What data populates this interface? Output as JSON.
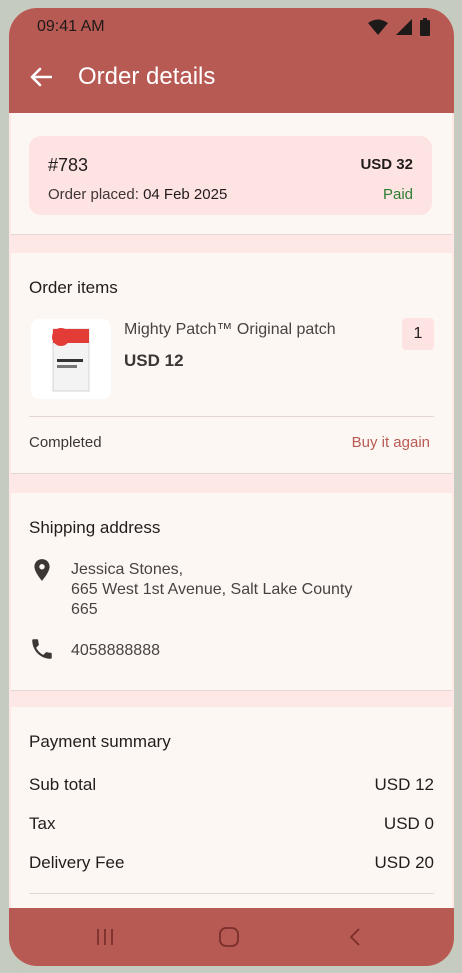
{
  "status_bar": {
    "time": "09:41 AM"
  },
  "app_bar": {
    "title": "Order details"
  },
  "order": {
    "id": "#783",
    "placed_label": "Order placed:",
    "placed_date": "04 Feb 2025",
    "total": "USD 32",
    "payment_status": "Paid"
  },
  "items_section": {
    "title": "Order items",
    "items": [
      {
        "name": "Mighty Patch™ Original patch",
        "price": "USD 12",
        "quantity": "1",
        "thumb_text": "MIGHTY\nPATCH"
      }
    ],
    "status": "Completed",
    "buy_again": "Buy it again"
  },
  "shipping": {
    "title": "Shipping address",
    "address_lines": [
      "Jessica Stones,",
      "665 West 1st Avenue, Salt Lake County",
      "665"
    ],
    "phone": "4058888888"
  },
  "payment": {
    "title": "Payment summary",
    "rows": [
      {
        "label": "Sub total",
        "value": "USD 12"
      },
      {
        "label": "Tax",
        "value": "USD 0"
      },
      {
        "label": "Delivery Fee",
        "value": "USD 20"
      }
    ]
  },
  "colors": {
    "accent": "#b85a54",
    "paid": "#2e7d32",
    "surface": "#fdf7f3",
    "tint": "#fde3e2"
  }
}
